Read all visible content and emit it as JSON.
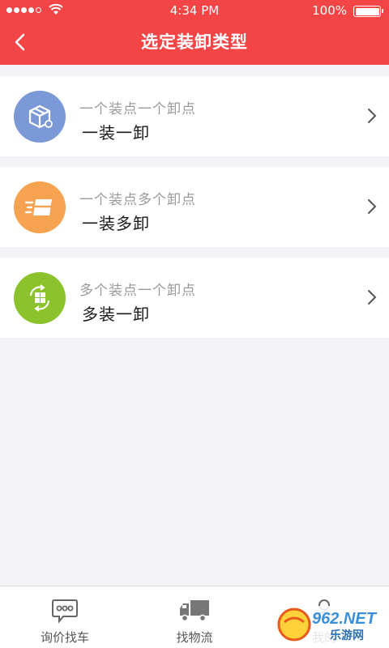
{
  "status_bar": {
    "time": "4:34 PM",
    "battery": "100%"
  },
  "header": {
    "title": "选定装卸类型"
  },
  "options": [
    {
      "subtitle": "一个装点一个卸点",
      "label": "一装一卸",
      "color": "#7b98d7",
      "icon": "box-icon"
    },
    {
      "subtitle": "一个装点多个卸点",
      "label": "一装多卸",
      "color": "#f5a350",
      "icon": "fast-box-icon"
    },
    {
      "subtitle": "多个装点一个卸点",
      "label": "多装一卸",
      "color": "#8cc22b",
      "icon": "boxes-cycle-icon"
    }
  ],
  "tabbar": {
    "tabs": [
      {
        "label": "询价找车",
        "icon": "chat-icon"
      },
      {
        "label": "找物流",
        "icon": "truck-icon"
      },
      {
        "label": "我的",
        "icon": "user-icon"
      }
    ]
  },
  "watermark": {
    "text": "962.NET",
    "subtext": "乐游网"
  }
}
